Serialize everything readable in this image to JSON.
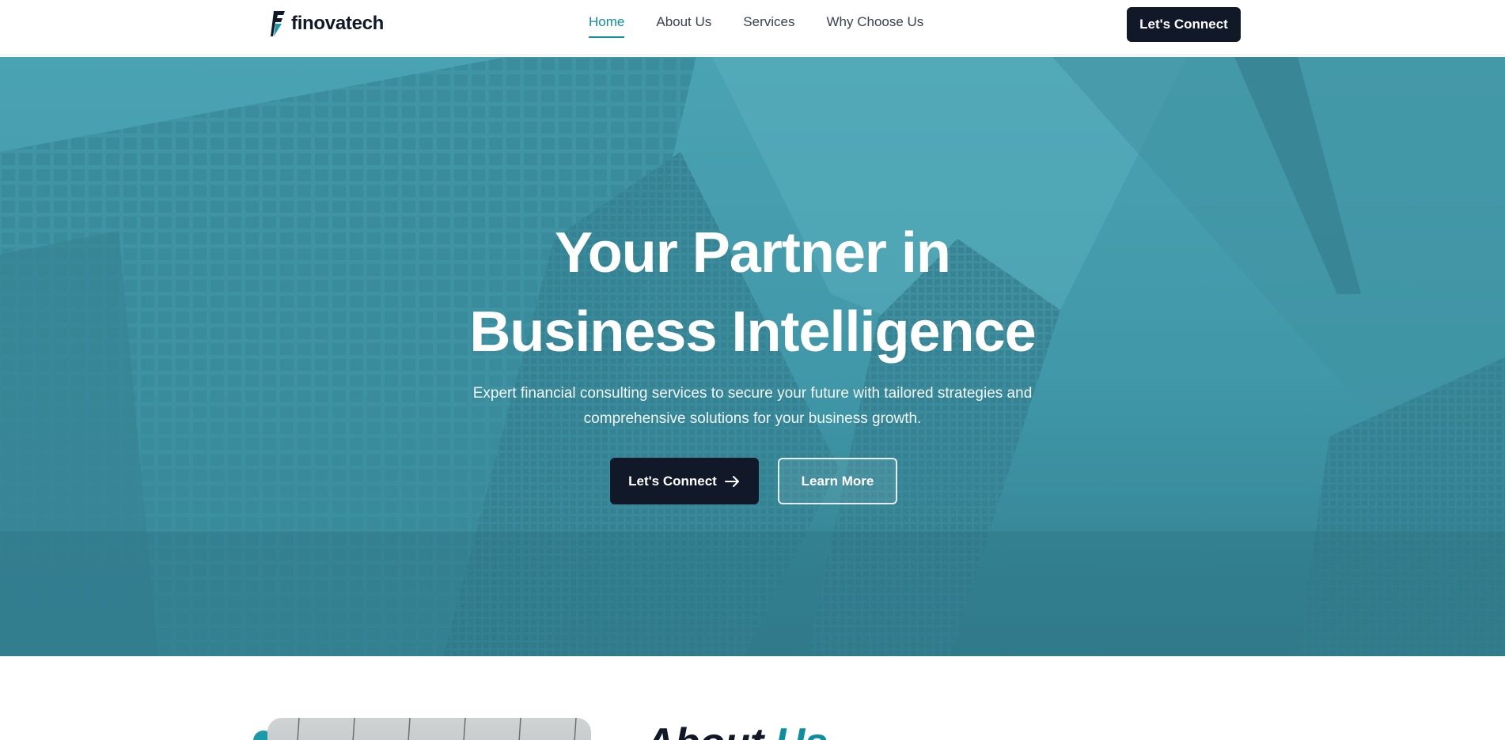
{
  "brand": {
    "name": "finovatech",
    "accent": "#0e8fa0",
    "dark": "#111827"
  },
  "nav": {
    "items": [
      {
        "label": "Home",
        "active": true
      },
      {
        "label": "About Us",
        "active": false
      },
      {
        "label": "Services",
        "active": false
      },
      {
        "label": "Why Choose Us",
        "active": false
      }
    ],
    "cta_label": "Let's Connect"
  },
  "hero": {
    "title_line1": "Your Partner in",
    "title_line2": "Business Intelligence",
    "subtitle": "Expert financial consulting services to secure your future with tailored strategies and comprehensive solutions for your business growth.",
    "primary_button": "Let's Connect",
    "primary_icon": "arrow-right-icon",
    "secondary_button": "Learn More"
  },
  "about": {
    "heading_part1": "About",
    "heading_part2": "Us"
  }
}
